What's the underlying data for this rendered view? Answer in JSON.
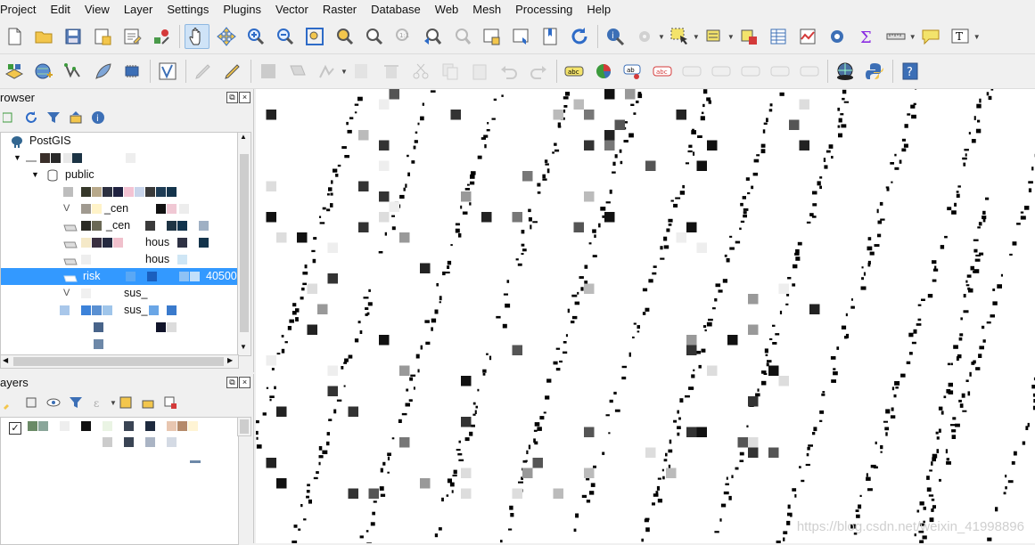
{
  "menu": [
    "Project",
    "Edit",
    "View",
    "Layer",
    "Settings",
    "Plugins",
    "Vector",
    "Raster",
    "Database",
    "Web",
    "Mesh",
    "Processing",
    "Help"
  ],
  "browser": {
    "title": "rowser",
    "tree": {
      "root": "PostGIS",
      "schema": "public",
      "items": [
        "_cen",
        "_cen",
        "hous",
        "hous",
        "risk",
        "sus_",
        "sus_"
      ],
      "selected_suffix": "40500"
    }
  },
  "layers": {
    "title": "ayers",
    "check": "✓"
  },
  "watermark": "https://blog.csdn.net/weixin_41998896",
  "colors": {
    "selection": "#3399ff",
    "map_bg": "#ffffff",
    "panel_bg": "#f0f0f0"
  }
}
